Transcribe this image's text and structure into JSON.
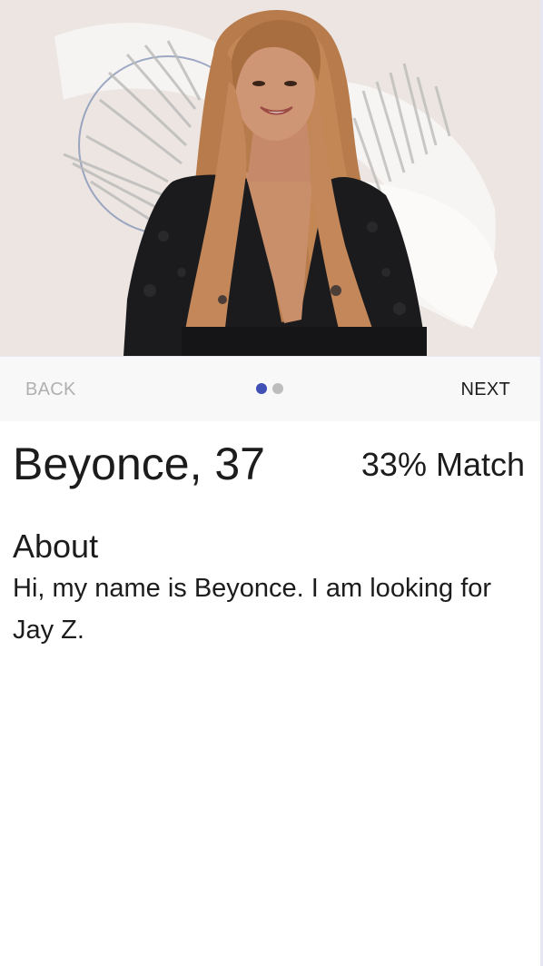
{
  "profile": {
    "name_age": "Beyonce, 37",
    "match": "33% Match",
    "about_heading": "About",
    "about_text": "Hi, my name is Beyonce. I am looking for Jay Z.",
    "photo_description": "profile-photo"
  },
  "stepper": {
    "back_label": "BACK",
    "next_label": "NEXT",
    "total_steps": 2,
    "active_step": 1
  },
  "colors": {
    "accent": "#3f51b5",
    "inactive_dot": "#bdbdbd",
    "stepper_bg": "#f8f8f8",
    "disabled_text": "#b0b0b0"
  }
}
